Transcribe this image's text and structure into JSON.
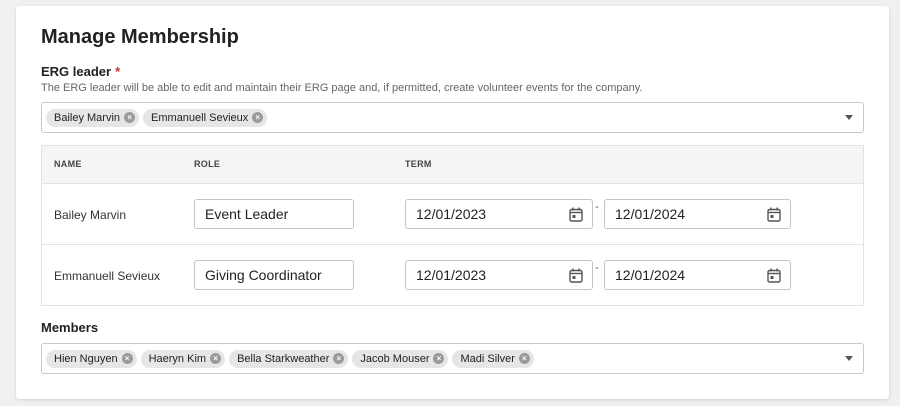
{
  "page": {
    "title": "Manage Membership"
  },
  "erg_leader": {
    "label": "ERG leader",
    "required_mark": "*",
    "helper_text": "The ERG leader will be able to edit and maintain their ERG page and, if permitted, create volunteer events for the company.",
    "selected": [
      "Bailey Marvin",
      "Emmanuell Sevieux"
    ]
  },
  "leaders_table": {
    "headers": {
      "name": "NAME",
      "role": "ROLE",
      "term": "TERM"
    },
    "rows": [
      {
        "name": "Bailey Marvin",
        "role": "Event Leader",
        "term_start": "12/01/2023",
        "term_separator": "-",
        "term_end": "12/01/2024"
      },
      {
        "name": "Emmanuell Sevieux",
        "role": "Giving Coordinator",
        "term_start": "12/01/2023",
        "term_separator": "-",
        "term_end": "12/01/2024"
      }
    ]
  },
  "members": {
    "label": "Members",
    "selected": [
      "Hien Nguyen",
      "Haeryn Kim",
      "Bella Starkweather",
      "Jacob Mouser",
      "Madi Silver"
    ]
  },
  "icons": {
    "chip_remove": "close-circle-icon",
    "dropdown": "caret-down-icon",
    "date_picker": "calendar-icon"
  },
  "colors": {
    "required": "#d32f2f",
    "chip_bg": "#e6e6e6",
    "table_header_bg": "#f5f5f5"
  }
}
